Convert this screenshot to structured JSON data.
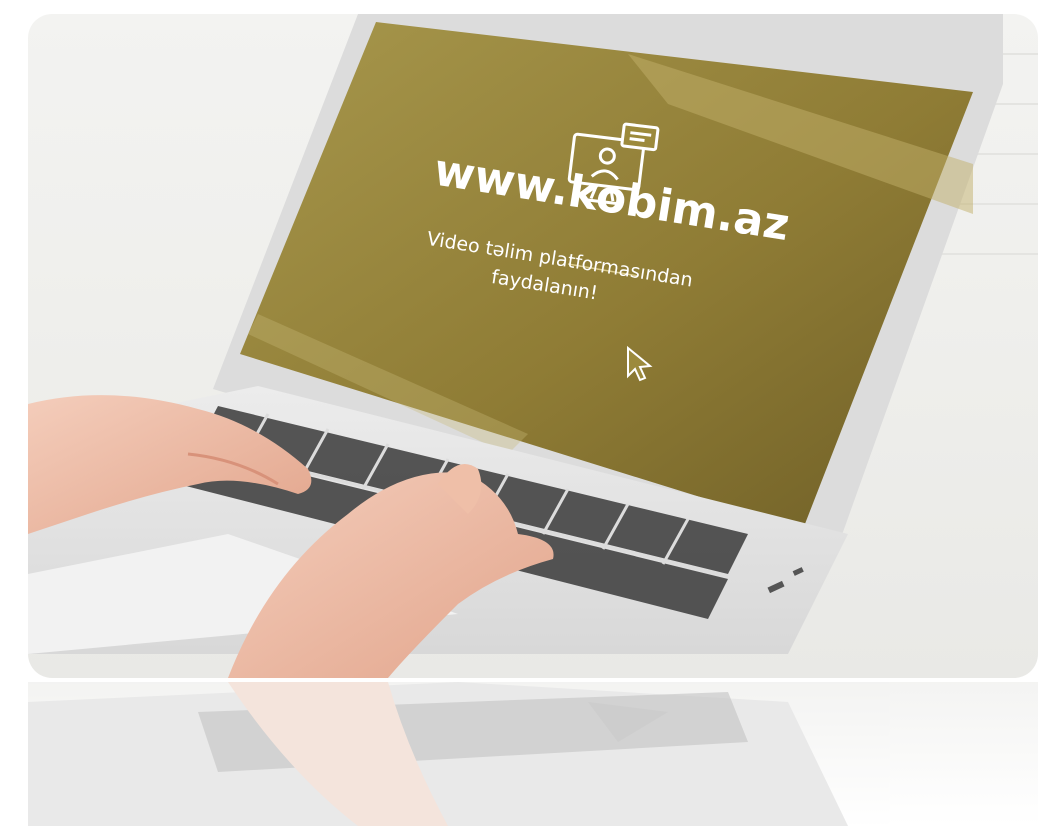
{
  "screen": {
    "url_text": "www.kobim.az",
    "tagline_line1": "Video təlim platformasından",
    "tagline_line2": "faydalanın!",
    "background_color": "#9c8a3c",
    "text_color": "#ffffff"
  },
  "icons": {
    "monitor": "video-lesson-monitor-icon",
    "cursor": "mouse-pointer-icon"
  }
}
